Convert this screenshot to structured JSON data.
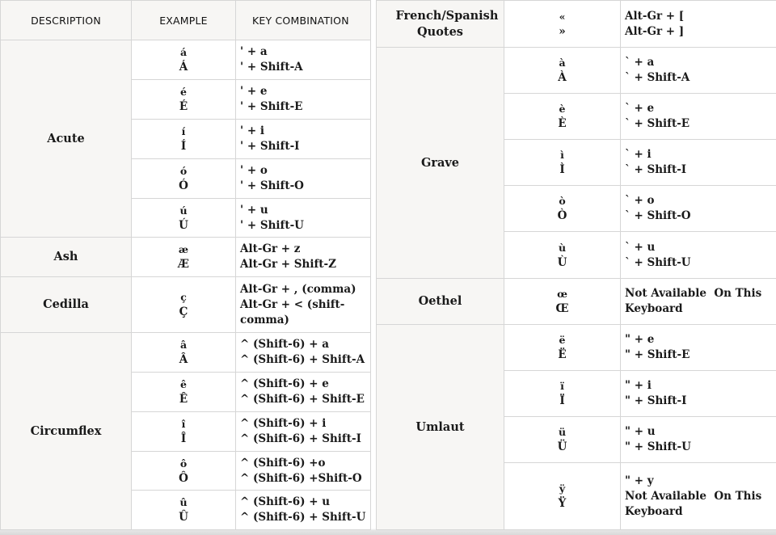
{
  "headers": {
    "description": "DESCRIPTION",
    "example": "EXAMPLE",
    "key_combination": "KEY COMBINATION"
  },
  "left_groups": [
    {
      "description": "Acute",
      "rows": [
        {
          "example": [
            "á",
            "Á"
          ],
          "keys": [
            "' + a",
            "' + Shift-A"
          ]
        },
        {
          "example": [
            "é",
            "É"
          ],
          "keys": [
            "' + e",
            "' + Shift-E"
          ]
        },
        {
          "example": [
            "í",
            "Í"
          ],
          "keys": [
            "' + i",
            "' + Shift-I"
          ]
        },
        {
          "example": [
            "ó",
            "Ó"
          ],
          "keys": [
            "' + o",
            "' + Shift-O"
          ]
        },
        {
          "example": [
            "ú",
            "Ú"
          ],
          "keys": [
            "' + u",
            "' + Shift-U"
          ]
        }
      ]
    },
    {
      "description": "Ash",
      "rows": [
        {
          "example": [
            "æ",
            "Æ"
          ],
          "keys": [
            "Alt-Gr + z",
            "Alt-Gr + Shift-Z"
          ]
        }
      ]
    },
    {
      "description": "Cedilla",
      "rows": [
        {
          "example": [
            "ç",
            "Ç"
          ],
          "keys": [
            "Alt-Gr + , (comma)",
            "Alt-Gr + < (shift-comma)"
          ]
        }
      ]
    },
    {
      "description": "Circumflex",
      "rows": [
        {
          "example": [
            "â",
            "Â"
          ],
          "keys": [
            "^ (Shift-6) + a",
            "^ (Shift-6) + Shift-A"
          ]
        },
        {
          "example": [
            "ê",
            "Ê"
          ],
          "keys": [
            "^ (Shift-6) + e",
            "^ (Shift-6) + Shift-E"
          ]
        },
        {
          "example": [
            "î",
            "Î"
          ],
          "keys": [
            "^ (Shift-6) + i",
            "^ (Shift-6) + Shift-I"
          ]
        },
        {
          "example": [
            "ô",
            "Ô"
          ],
          "keys": [
            "^ (Shift-6) +o",
            "^ (Shift-6) +Shift-O"
          ]
        },
        {
          "example": [
            "û",
            "Û"
          ],
          "keys": [
            "^ (Shift-6) + u",
            "^ (Shift-6) + Shift-U"
          ]
        }
      ]
    }
  ],
  "right_groups": [
    {
      "description": "French/Spanish Quotes",
      "rows": [
        {
          "example": [
            "«",
            "»"
          ],
          "keys": [
            "Alt-Gr + [",
            "Alt-Gr + ]"
          ]
        }
      ]
    },
    {
      "description": "Grave",
      "rows": [
        {
          "example": [
            "à",
            "À"
          ],
          "keys": [
            "` + a",
            "` + Shift-A"
          ]
        },
        {
          "example": [
            "è",
            "È"
          ],
          "keys": [
            "` + e",
            "` + Shift-E"
          ]
        },
        {
          "example": [
            "ì",
            "Ì"
          ],
          "keys": [
            "` + i",
            "` + Shift-I"
          ]
        },
        {
          "example": [
            "ò",
            "Ò"
          ],
          "keys": [
            "` + o",
            "` + Shift-O"
          ]
        },
        {
          "example": [
            "ù",
            "Ù"
          ],
          "keys": [
            "` + u",
            "` + Shift-U"
          ]
        }
      ]
    },
    {
      "description": "Oethel",
      "rows": [
        {
          "example": [
            "œ",
            "Œ"
          ],
          "keys": [
            "Not Available  On This Keyboard"
          ]
        }
      ]
    },
    {
      "description": "Umlaut",
      "rows": [
        {
          "example": [
            "ë",
            "Ë"
          ],
          "keys": [
            "\" + e",
            "\" + Shift-E"
          ]
        },
        {
          "example": [
            "ï",
            "Ï"
          ],
          "keys": [
            "\" + i",
            "\" + Shift-I"
          ]
        },
        {
          "example": [
            "ü",
            "Ü"
          ],
          "keys": [
            "\" + u",
            "\" + Shift-U"
          ]
        },
        {
          "example": [
            "ÿ",
            "Ÿ"
          ],
          "keys": [
            "\" + y",
            "Not Available  On This Keyboard"
          ]
        }
      ]
    }
  ]
}
